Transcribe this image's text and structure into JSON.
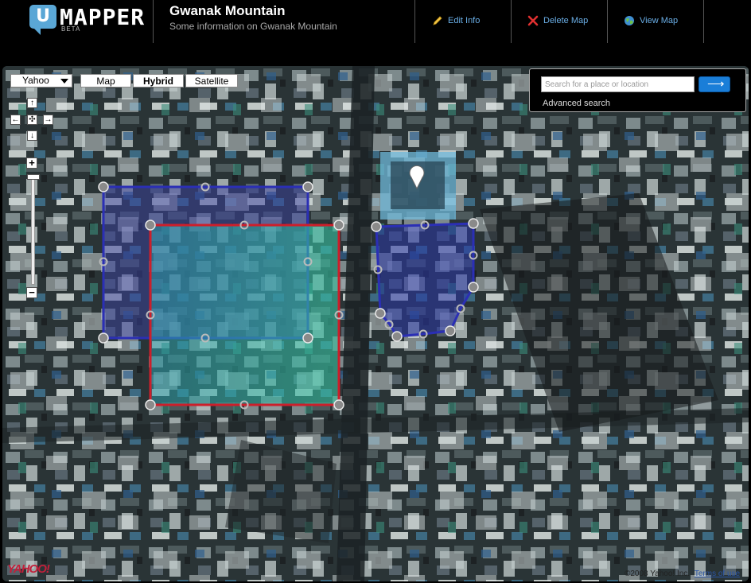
{
  "app": {
    "logo_letter": "U",
    "logo_name": "MAPPER",
    "logo_tag": "BETA"
  },
  "map_info": {
    "title": "Gwanak Mountain",
    "subtitle": "Some information on Gwanak Mountain"
  },
  "header_actions": [
    {
      "label": "Edit Info",
      "icon": "pencil-icon"
    },
    {
      "label": "Delete Map",
      "icon": "delete-x-icon"
    },
    {
      "label": "View Map",
      "icon": "globe-icon"
    }
  ],
  "provider_select": {
    "selected": "Yahoo"
  },
  "map_types": {
    "map": "Map",
    "hybrid": "Hybrid",
    "satellite": "Satellite",
    "active": "Hybrid"
  },
  "pan_controls": {
    "up": "↑",
    "down": "↓",
    "left": "←",
    "right": "→",
    "center": "✣"
  },
  "zoom_controls": {
    "in": "+",
    "out": "−"
  },
  "search": {
    "placeholder": "Search for a place or location",
    "value": "",
    "advanced_label": "Advanced search"
  },
  "footer": {
    "provider_logo": "YAHOO!",
    "copyright": "©2008 Yahoo! Inc.",
    "terms": "Terms of use"
  },
  "colors": {
    "header_bg": "#000000",
    "link_blue": "#6aaee6",
    "shape_red": "#cc1f2b",
    "shape_blue": "#2b2fb5",
    "search_btn": "#1a7ed8"
  }
}
